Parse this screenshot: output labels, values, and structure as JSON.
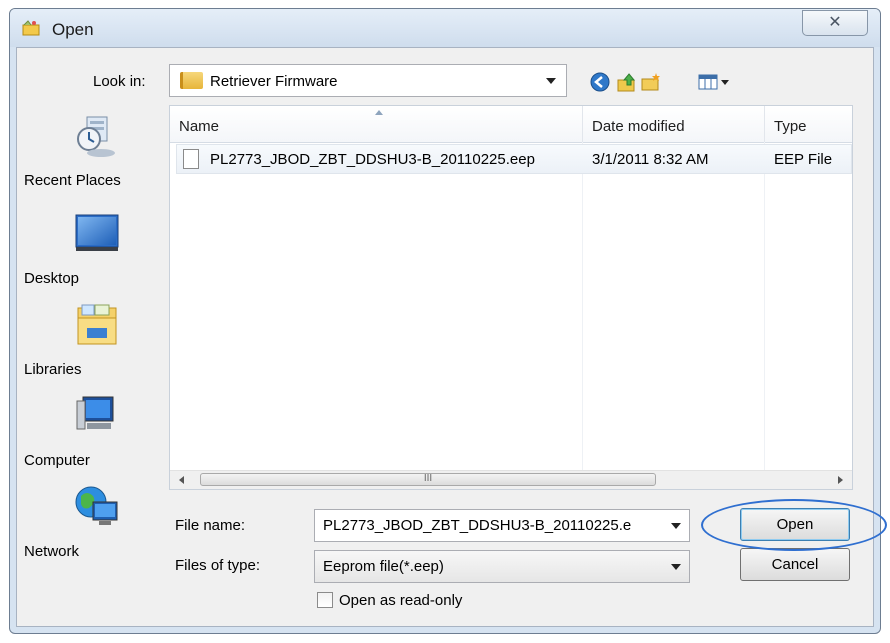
{
  "window": {
    "title": "Open",
    "close_glyph": "✕"
  },
  "lookin": {
    "label": "Look in:",
    "value": "Retriever Firmware"
  },
  "toolbar": {
    "icons": [
      "back-icon",
      "up-folder-icon",
      "new-folder-icon",
      "views-menu-icon"
    ]
  },
  "places": [
    {
      "label": "Recent Places",
      "icon": "recent-places-icon"
    },
    {
      "label": "Desktop",
      "icon": "desktop-icon"
    },
    {
      "label": "Libraries",
      "icon": "libraries-icon"
    },
    {
      "label": "Computer",
      "icon": "computer-icon"
    },
    {
      "label": "Network",
      "icon": "network-icon"
    }
  ],
  "filelist": {
    "columns": [
      "Name",
      "Date modified",
      "Type"
    ],
    "rows": [
      {
        "name": "PL2773_JBOD_ZBT_DDSHU3-B_20110225.eep",
        "date": "3/1/2011 8:32 AM",
        "type": "EEP File"
      }
    ],
    "scroll_grip": "III"
  },
  "form": {
    "filename_label": "File name:",
    "filename_value": "PL2773_JBOD_ZBT_DDSHU3-B_20110225.e",
    "filetype_label": "Files of type:",
    "filetype_value": "Eeprom file(*.eep)",
    "readonly_label": "Open as read-only",
    "readonly_checked": false
  },
  "buttons": {
    "open": "Open",
    "cancel": "Cancel"
  },
  "colors": {
    "highlight_ellipse": "#2f6fd0",
    "window_frame": "#d6e3f1"
  }
}
